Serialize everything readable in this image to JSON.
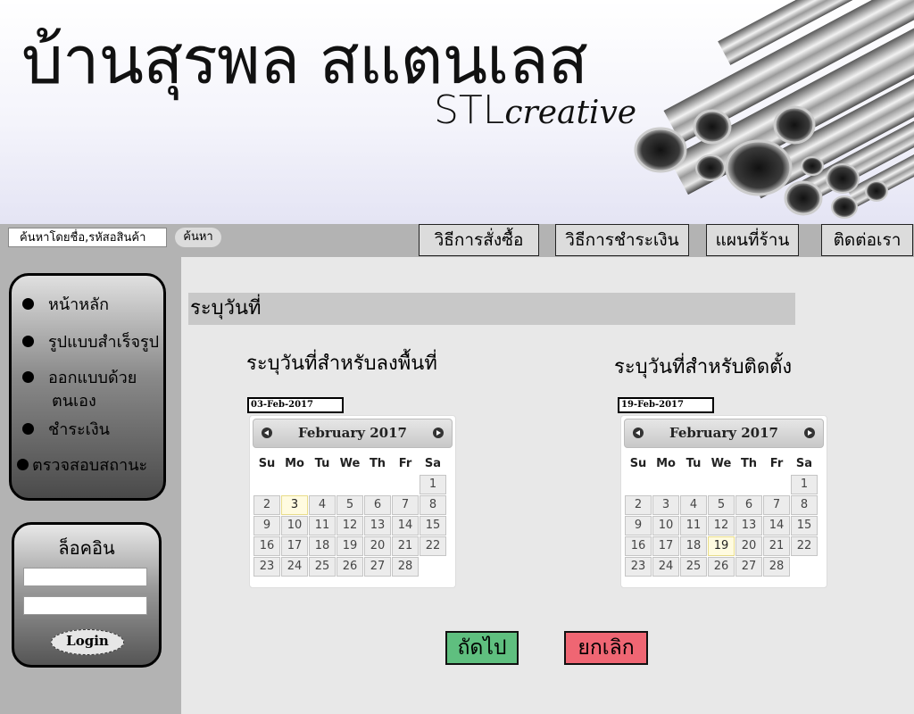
{
  "header": {
    "title": "บ้านสุรพล สแตนเลส",
    "brand_stl": "STL",
    "brand_creative": "creative"
  },
  "search": {
    "placeholder": "ค้นหาโดยชื่อ,รหัสอสินค้า",
    "button_label": "ค้นหา"
  },
  "nav": {
    "items": [
      {
        "label": "วิธีการสั่งซื้อ"
      },
      {
        "label": "วิธีการชำระเงิน"
      },
      {
        "label": "แผนที่ร้าน"
      },
      {
        "label": "ติดต่อเรา"
      }
    ]
  },
  "sidebar": {
    "menu": [
      {
        "label": "หน้าหลัก"
      },
      {
        "label": "รูปแบบสำเร็จรูป"
      },
      {
        "label": "ออกแบบด้วย",
        "label2": "ตนเอง"
      },
      {
        "label": "ชำระเงิน"
      },
      {
        "label": "ตรวจสอบสถานะ"
      }
    ],
    "login": {
      "title": "ล็อคอิน",
      "button_label": "Login"
    }
  },
  "main": {
    "section_title": "ระบุวันที่",
    "survey": {
      "label": "ระบุวันที่สำหรับลงพื้นที่",
      "date_value": "03-Feb-2017",
      "calendar_title": "February 2017",
      "selected_day": "3"
    },
    "install": {
      "label": "ระบุวันที่สำหรับติดตั้ง",
      "date_value": "19-Feb-2017",
      "calendar_title": "February 2017",
      "selected_day": "19"
    },
    "weekdays": [
      "Su",
      "Mo",
      "Tu",
      "We",
      "Th",
      "Fr",
      "Sa"
    ],
    "next_label": "ถัดไป",
    "cancel_label": "ยกเลิก"
  },
  "colors": {
    "next_button": "#5fbf7f",
    "cancel_button": "#ef6673",
    "sidebar_bg": "#b3b3b3",
    "calendar_highlight": "#fffbe0"
  }
}
